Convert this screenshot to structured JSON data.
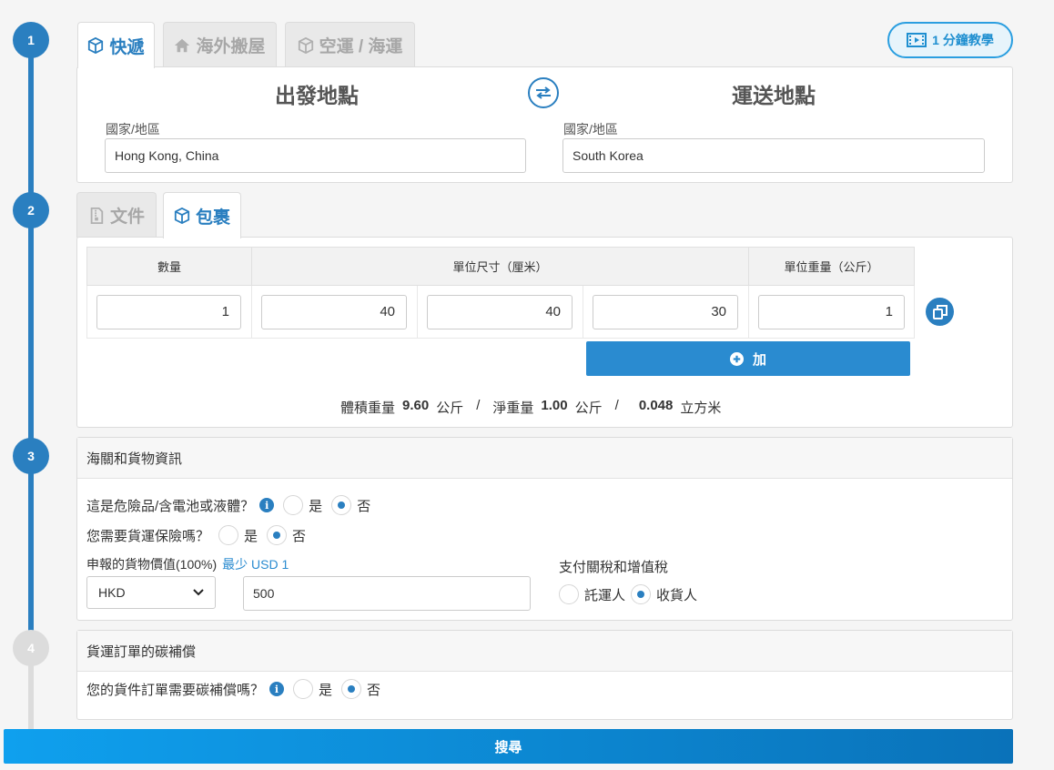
{
  "steps": [
    "1",
    "2",
    "3",
    "4"
  ],
  "service_tabs": [
    {
      "label": "快遞",
      "icon": "box-icon",
      "active": true
    },
    {
      "label": "海外搬屋",
      "icon": "home-icon",
      "active": false
    },
    {
      "label": "空運 / 海運",
      "icon": "box-icon",
      "active": false
    }
  ],
  "tutorial": {
    "label": "1 分鐘教學",
    "icon": "film-icon"
  },
  "route": {
    "origin_title": "出發地點",
    "destination_title": "運送地點",
    "country_label": "國家/地區",
    "origin_value": "Hong Kong, China",
    "destination_value": "South Korea"
  },
  "package_tabs": [
    {
      "label": "文件",
      "icon": "document-icon",
      "active": false
    },
    {
      "label": "包裹",
      "icon": "box-icon",
      "active": true
    }
  ],
  "dimensions": {
    "headers": {
      "quantity": "數量",
      "size": "單位尺寸（厘米）",
      "weight": "單位重量（公斤）"
    },
    "row": {
      "quantity": "1",
      "length": "40",
      "width": "40",
      "height": "30",
      "weight": "1"
    }
  },
  "add_button": "加",
  "summary": {
    "vol_label": "體積重量",
    "vol_value": "9.60",
    "vol_unit": "公斤",
    "sep": "/",
    "net_label": "淨重量",
    "net_value": "1.00",
    "net_unit": "公斤",
    "cbm_value": "0.048",
    "cbm_unit": "立方米"
  },
  "customs": {
    "title": "海關和貨物資訊",
    "dangerous_q": "這是危險品/含電池或液體？",
    "insurance_q": "您需要貨運保險嗎？",
    "yes": "是",
    "no": "否",
    "declared_label": "申報的貨物價值(100%)",
    "declared_min": "最少 USD 1",
    "currency": "HKD",
    "declared_value": "500",
    "duty_label": "支付關稅和增值稅",
    "duty_shipper": "託運人",
    "duty_consignee": "收貨人"
  },
  "carbon": {
    "title": "貨運訂單的碳補償",
    "question": "您的貨件訂單需要碳補償嗎？",
    "yes": "是",
    "no": "否"
  },
  "search_button": "搜尋",
  "colors": {
    "primary": "#2a7fc0",
    "rail_inactive": "#dcdcdc"
  }
}
